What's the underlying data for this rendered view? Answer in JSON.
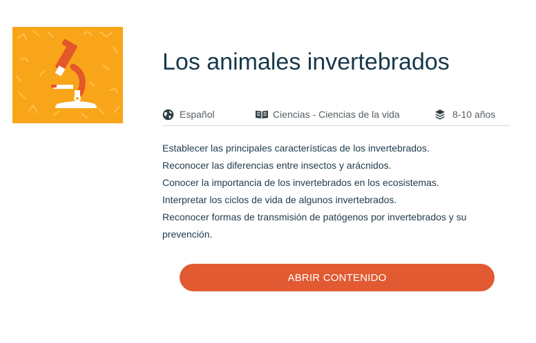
{
  "resource": {
    "title": "Los animales invertebrados",
    "thumbnail_icon": "microscope-icon",
    "thumbnail_background": "#f9a51a",
    "meta": {
      "language": {
        "icon": "globe-icon",
        "label": "Español"
      },
      "subject": {
        "icon": "open-book-icon",
        "label": "Ciencias - Ciencias de la vida"
      },
      "age": {
        "icon": "layers-icon",
        "label": "8-10 años"
      }
    },
    "objectives": [
      "Establecer las principales características de los invertebrados.",
      "Reconocer las diferencias entre insectos y arácnidos.",
      "Conocer la importancia de los invertebrados en los ecosistemas.",
      "Interpretar los ciclos de vida de algunos invertebrados.",
      "Reconocer formas de transmisión de patógenos por invertebrados y su",
      "prevención."
    ],
    "open_button_label": "ABRIR CONTENIDO",
    "colors": {
      "accent": "#e15a32",
      "title_text": "#16384a",
      "icon_orange": "#e3572b"
    }
  }
}
